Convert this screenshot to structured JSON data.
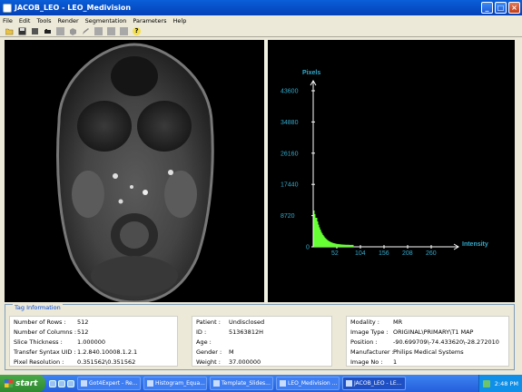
{
  "window": {
    "title": "JACOB_LEO - LEO_Medivision",
    "minimize": "_",
    "maximize": "□",
    "close": "×"
  },
  "menu": [
    "File",
    "Edit",
    "Tools",
    "Render",
    "Segmentation",
    "Parameters",
    "Help"
  ],
  "toolbar": {
    "help_glyph": "?"
  },
  "histogram": {
    "y_axis_title": "Pixels",
    "x_axis_title": "Intensity",
    "y_ticks": [
      "43600",
      "34880",
      "26160",
      "17440",
      "8720",
      "0"
    ],
    "x_ticks": [
      "52",
      "104",
      "156",
      "208",
      "260"
    ],
    "curve_color": "#66ff33",
    "axis_color": "#ffffff",
    "label_color": "#33aacc"
  },
  "tag_info": {
    "title": "Tag Information",
    "col1": [
      {
        "label": "Number of Rows :",
        "value": "512"
      },
      {
        "label": "Number of Columns :",
        "value": "512"
      },
      {
        "label": "Slice Thickness :",
        "value": "1.000000"
      },
      {
        "label": "Transfer Syntax UID :",
        "value": "1.2.840.10008.1.2.1"
      },
      {
        "label": "Pixel Resolution :",
        "value": "0.351562\\0.351562"
      }
    ],
    "col2": [
      {
        "label": "Patient :",
        "value": "Undisclosed"
      },
      {
        "label": "ID :",
        "value": "51363812H"
      },
      {
        "label": "Age :",
        "value": ""
      },
      {
        "label": "Gender :",
        "value": "M"
      },
      {
        "label": "Weight :",
        "value": "37.000000"
      }
    ],
    "col3": [
      {
        "label": "Modality :",
        "value": "MR"
      },
      {
        "label": "Image Type :",
        "value": "ORIGINAL\\PRIMARY\\T1 MAP"
      },
      {
        "label": "Position :",
        "value": "-90.699709\\-74.433620\\-28.272010"
      },
      {
        "label": "Manufacturer :",
        "value": "Philips Medical Systems"
      },
      {
        "label": "Image No :",
        "value": "1"
      }
    ]
  },
  "taskbar": {
    "start_label": "start",
    "tasks": [
      "Got4Expert - Re...",
      "Histogram_Equa...",
      "Template_Slides...",
      "LEO_Medivision ...",
      "JACOB_LEO - LE..."
    ],
    "clock": "2:48 PM"
  }
}
